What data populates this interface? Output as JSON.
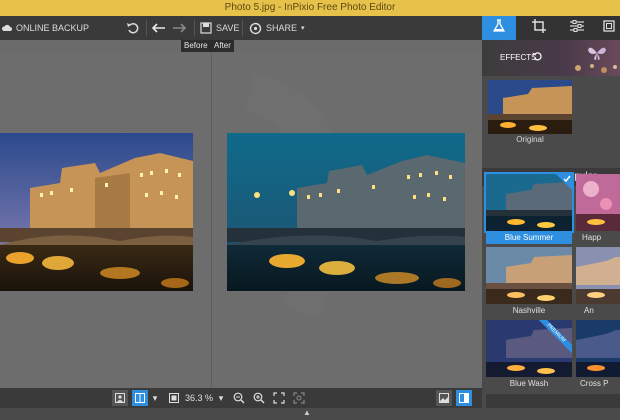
{
  "window": {
    "title": "Photo 5.jpg - InPixio Free Photo Editor"
  },
  "toolbar": {
    "online_backup": "ONLINE BACKUP",
    "save": "SAVE",
    "share": "SHARE",
    "share_caret": "▾"
  },
  "compare": {
    "before": "Before",
    "after": "After"
  },
  "bottombar": {
    "zoom": "36.3 %",
    "caret": "▾"
  },
  "panel": {
    "effects_label": "EFFECTS",
    "original_label": "Original",
    "popular_label": "Popular",
    "filters": [
      {
        "name": "Blue Summer",
        "selected": true
      },
      {
        "name": "Happ",
        "selected": false
      },
      {
        "name": "Nashville",
        "selected": false
      },
      {
        "name": "An",
        "selected": false
      },
      {
        "name": "Blue Wash",
        "selected": false,
        "badge": "PREMIUM"
      },
      {
        "name": "Cross P",
        "selected": false
      }
    ]
  },
  "colors": {
    "accent": "#2e8fe0",
    "titlebar": "#e6c24a",
    "toolbar": "#3a3a3a"
  }
}
